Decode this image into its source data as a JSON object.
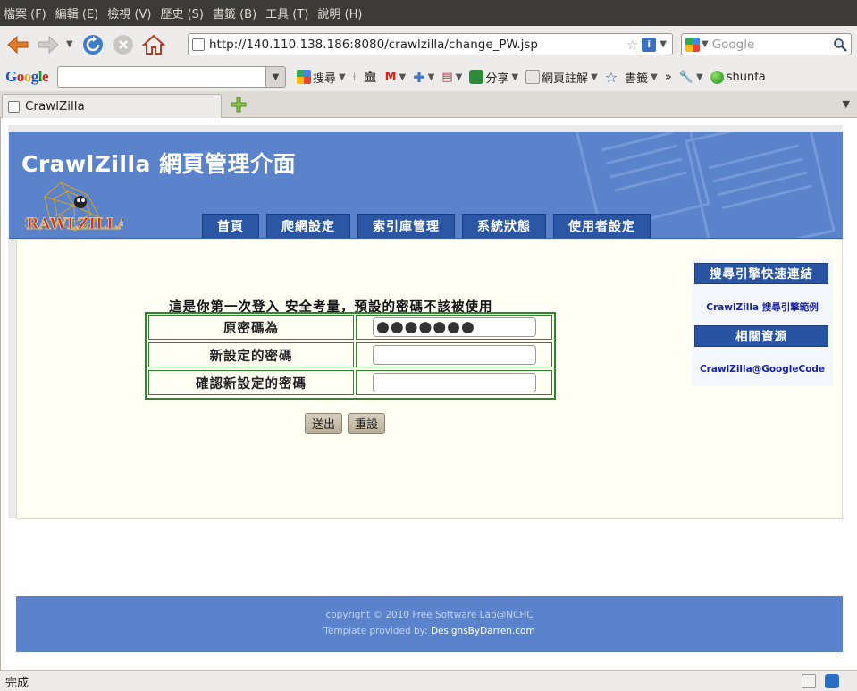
{
  "menubar": {
    "items": [
      "檔案 (F)",
      "編輯 (E)",
      "檢視 (V)",
      "歷史 (S)",
      "書籤 (B)",
      "工具 (T)",
      "說明 (H)"
    ]
  },
  "navbar": {
    "url": "http://140.110.138.186:8080/crawlzilla/change_PW.jsp",
    "search_placeholder": "Google"
  },
  "google_toolbar": {
    "logo": [
      "G",
      "o",
      "o",
      "g",
      "l",
      "e"
    ],
    "search_label": "搜尋",
    "share_label": "分享",
    "annotate_label": "網頁註解",
    "bookmarks_label": "書籤",
    "overflow": "»",
    "user": "shunfa"
  },
  "tab": {
    "title": "CrawlZilla"
  },
  "site": {
    "title": "CrawlZilla 網頁管理介面",
    "logo_text": "CRAWLZILLA",
    "nav": [
      "首頁",
      "爬網設定",
      "索引庫管理",
      "系統狀態",
      "使用者設定"
    ]
  },
  "form": {
    "title": "這是你第一次登入 安全考量，預設的密碼不該被使用",
    "rows": [
      {
        "label": "原密碼為",
        "value": "●●●●●●●"
      },
      {
        "label": "新設定的密碼",
        "value": ""
      },
      {
        "label": "確認新設定的密碼",
        "value": ""
      }
    ],
    "submit_label": "送出",
    "reset_label": "重設"
  },
  "sidebar": {
    "section1_title": "搜尋引擎快速連結",
    "section1_link": "CrawlZilla 搜尋引擎範例",
    "section2_title": "相關資源",
    "section2_link": "CrawlZilla@GoogleCode"
  },
  "footer": {
    "copyright": "copyright © 2010 Free Software Lab@NCHC",
    "template_prefix": "Template provided by: ",
    "template_link": "DesignsByDarren.com"
  },
  "status": {
    "text": "完成"
  },
  "colors": {
    "header_blue": "#5a83cc",
    "nav_tab_blue": "#2a56a3",
    "form_border_green": "#2a8a2a",
    "content_bg": "#fffff4"
  }
}
